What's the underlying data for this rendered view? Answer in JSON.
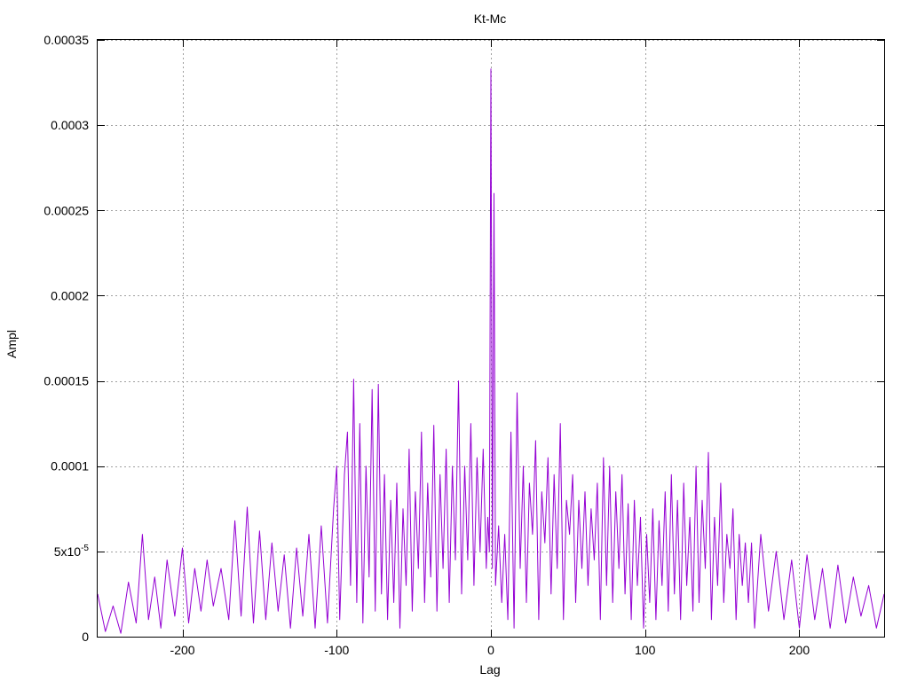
{
  "chart_data": {
    "type": "line",
    "title": "Kt-Mc",
    "xlabel": "Lag",
    "ylabel": "Ampl",
    "xlim": [
      -255,
      255
    ],
    "ylim": [
      0,
      0.00035
    ],
    "grid": true,
    "legend": "none",
    "line_color": "#9400d3",
    "x_ticks": [
      {
        "value": -200,
        "label": "-200"
      },
      {
        "value": -100,
        "label": "-100"
      },
      {
        "value": 0,
        "label": "0"
      },
      {
        "value": 100,
        "label": "100"
      },
      {
        "value": 200,
        "label": "200"
      }
    ],
    "y_ticks": [
      {
        "value": 0,
        "label": "0"
      },
      {
        "value": 5e-05,
        "label": "5x10-5",
        "mantissa": "5x10",
        "exponent": "-5"
      },
      {
        "value": 0.0001,
        "label": "0.0001"
      },
      {
        "value": 0.00015,
        "label": "0.00015"
      },
      {
        "value": 0.0002,
        "label": "0.0002"
      },
      {
        "value": 0.00025,
        "label": "0.00025"
      },
      {
        "value": 0.0003,
        "label": "0.0003"
      },
      {
        "value": 0.00035,
        "label": "0.00035"
      }
    ],
    "series": [
      {
        "x": [
          -255,
          -250,
          -245,
          -240,
          -235,
          -230,
          -226,
          -222,
          -218,
          -214,
          -210,
          -205,
          -200,
          -196,
          -192,
          -188,
          -184,
          -180,
          -175,
          -170,
          -166,
          -162,
          -158,
          -154,
          -150,
          -146,
          -142,
          -138,
          -134,
          -130,
          -126,
          -122,
          -118,
          -114,
          -110,
          -106,
          -102,
          -100,
          -98,
          -95,
          -93,
          -91,
          -89,
          -87,
          -85,
          -83,
          -81,
          -79,
          -77,
          -75,
          -73,
          -71,
          -69,
          -67,
          -65,
          -63,
          -61,
          -59,
          -57,
          -55,
          -53,
          -51,
          -49,
          -47,
          -45,
          -43,
          -41,
          -39,
          -37,
          -35,
          -33,
          -31,
          -29,
          -27,
          -25,
          -23,
          -21,
          -19,
          -17,
          -15,
          -13,
          -11,
          -9,
          -7,
          -5,
          -3,
          -2,
          -1,
          0,
          1,
          2,
          3,
          5,
          7,
          9,
          11,
          13,
          15,
          17,
          19,
          21,
          23,
          25,
          27,
          29,
          31,
          33,
          35,
          37,
          39,
          41,
          43,
          45,
          47,
          49,
          51,
          53,
          55,
          57,
          59,
          61,
          63,
          65,
          67,
          69,
          71,
          73,
          75,
          77,
          79,
          81,
          83,
          85,
          87,
          89,
          91,
          93,
          95,
          97,
          99,
          101,
          103,
          105,
          107,
          109,
          111,
          113,
          115,
          117,
          119,
          121,
          123,
          125,
          127,
          129,
          131,
          133,
          135,
          137,
          139,
          141,
          143,
          145,
          147,
          149,
          151,
          153,
          155,
          157,
          159,
          161,
          163,
          165,
          167,
          169,
          171,
          175,
          180,
          185,
          190,
          195,
          200,
          205,
          210,
          215,
          220,
          225,
          230,
          235,
          240,
          245,
          250,
          255
        ],
        "y": [
          2.5e-05,
          3e-06,
          1.8e-05,
          2e-06,
          3.2e-05,
          8e-06,
          6e-05,
          1e-05,
          3.5e-05,
          5e-06,
          4.5e-05,
          1.2e-05,
          5.2e-05,
          8e-06,
          4e-05,
          1.5e-05,
          4.5e-05,
          1.8e-05,
          4e-05,
          1e-05,
          6.8e-05,
          1.2e-05,
          7.6e-05,
          8e-06,
          6.2e-05,
          1e-05,
          5.5e-05,
          1.5e-05,
          4.8e-05,
          5e-06,
          5.2e-05,
          1.2e-05,
          6e-05,
          5e-06,
          6.5e-05,
          8e-06,
          7.5e-05,
          0.0001,
          1e-05,
          9.5e-05,
          0.00012,
          3e-05,
          0.000151,
          2e-05,
          0.000125,
          8e-06,
          0.0001,
          3.5e-05,
          0.000145,
          1.5e-05,
          0.000148,
          2.5e-05,
          9.5e-05,
          1e-05,
          8e-05,
          2e-05,
          9e-05,
          5e-06,
          7.5e-05,
          3e-05,
          0.00011,
          1.5e-05,
          8.5e-05,
          4e-05,
          0.00012,
          2e-05,
          9e-05,
          3.5e-05,
          0.000124,
          1.5e-05,
          9.5e-05,
          4e-05,
          0.00011,
          2e-05,
          0.0001,
          4.5e-05,
          0.00015,
          2.5e-05,
          0.0001,
          4.5e-05,
          0.000125,
          3e-05,
          0.000105,
          5e-05,
          0.00011,
          4e-05,
          7e-05,
          5e-05,
          0.000333,
          4e-05,
          0.00026,
          3e-05,
          6.5e-05,
          2e-05,
          6e-05,
          1e-05,
          0.00012,
          5e-06,
          0.000143,
          4e-05,
          0.0001,
          2e-05,
          9e-05,
          6e-05,
          0.000115,
          1e-05,
          8.5e-05,
          5.5e-05,
          0.000105,
          2.5e-05,
          9.5e-05,
          4e-05,
          0.000125,
          1e-05,
          8e-05,
          6e-05,
          9.5e-05,
          2e-05,
          8e-05,
          4e-05,
          8.5e-05,
          3e-05,
          7.5e-05,
          4.5e-05,
          9e-05,
          1e-05,
          0.000105,
          3e-05,
          0.0001,
          2e-05,
          8.5e-05,
          4e-05,
          9.5e-05,
          2.5e-05,
          7.8e-05,
          1e-05,
          8e-05,
          3e-05,
          7e-05,
          5e-06,
          6e-05,
          2e-05,
          7.5e-05,
          1e-05,
          6.8e-05,
          3e-05,
          8.5e-05,
          1.5e-05,
          9.5e-05,
          2.5e-05,
          8e-05,
          1e-05,
          9e-05,
          3e-05,
          7e-05,
          1.5e-05,
          0.0001,
          2e-05,
          8e-05,
          4e-05,
          0.000108,
          1e-05,
          7e-05,
          3e-05,
          9e-05,
          2e-05,
          6e-05,
          4e-05,
          7.5e-05,
          1e-05,
          6e-05,
          3e-05,
          5.5e-05,
          2e-05,
          5.5e-05,
          5e-06,
          6e-05,
          1.5e-05,
          5e-05,
          1e-05,
          4.5e-05,
          5e-06,
          4.8e-05,
          1e-05,
          4e-05,
          5e-06,
          4.2e-05,
          8e-06,
          3.5e-05,
          1.2e-05,
          3e-05,
          5e-06,
          2.5e-05
        ]
      }
    ]
  }
}
